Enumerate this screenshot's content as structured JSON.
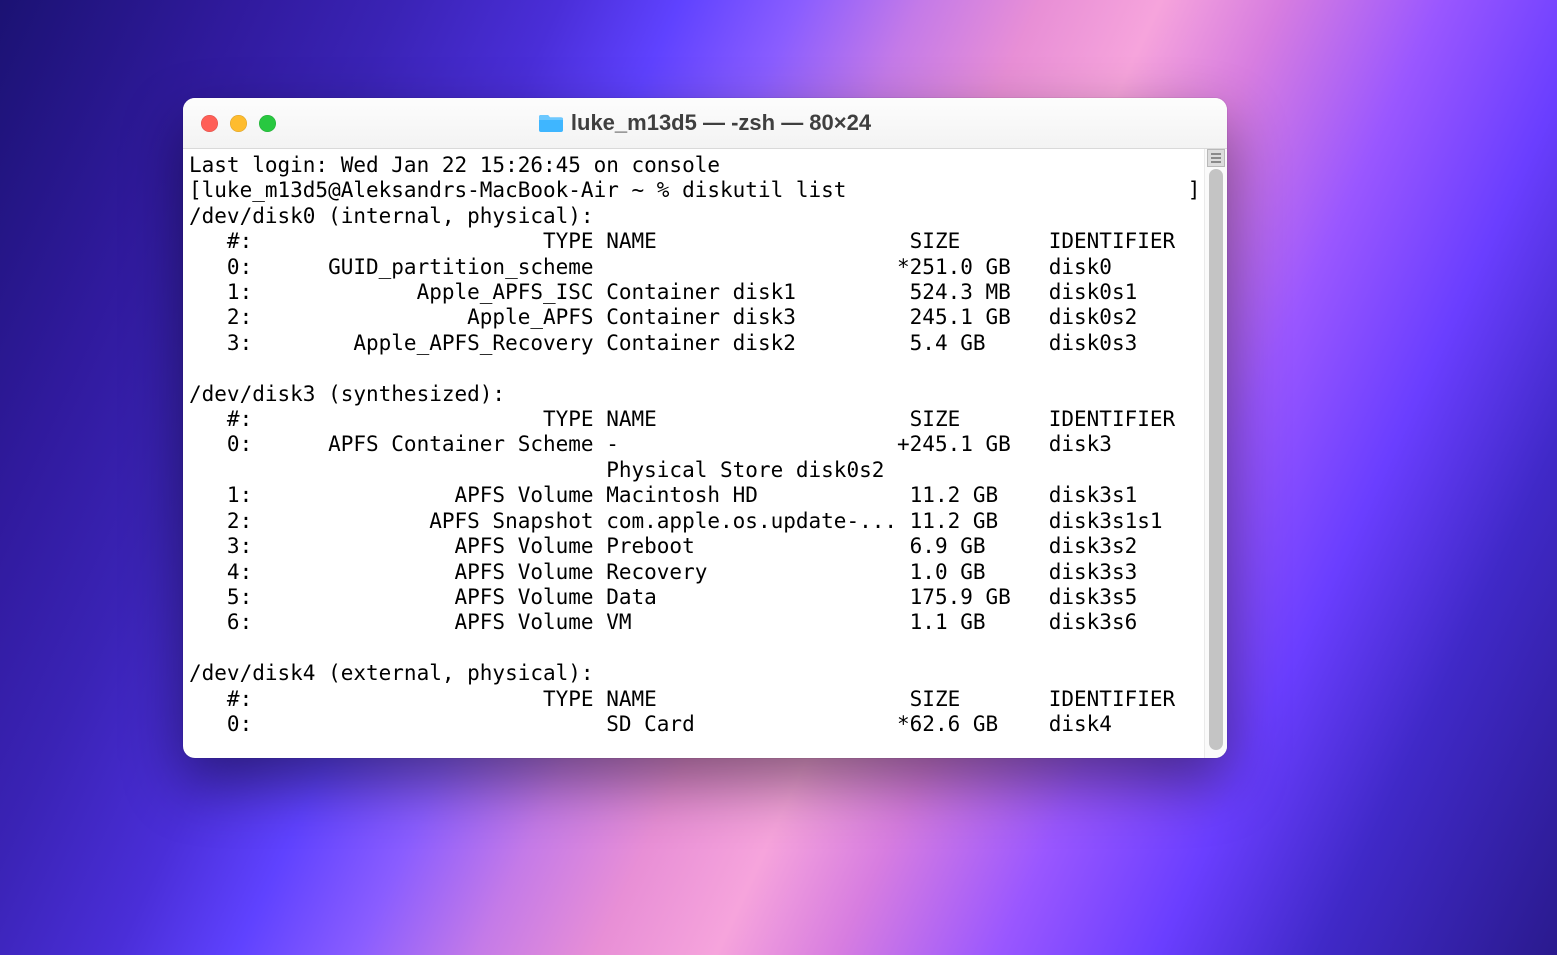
{
  "window": {
    "title": "luke_m13d5 — -zsh — 80×24"
  },
  "terminal": {
    "last_login": "Last login: Wed Jan 22 15:26:45 on console",
    "prompt_open": "[",
    "prompt": "luke_m13d5@Aleksandrs-MacBook-Air ~ % ",
    "command": "diskutil list",
    "prompt_close_col": 79,
    "disks": [
      {
        "header": "/dev/disk0 (internal, physical):",
        "columns": "   #:                       TYPE NAME                    SIZE       IDENTIFIER",
        "rows": [
          "   0:      GUID_partition_scheme                        *251.0 GB   disk0",
          "   1:             Apple_APFS_ISC Container disk1         524.3 MB   disk0s1",
          "   2:                 Apple_APFS Container disk3         245.1 GB   disk0s2",
          "   3:        Apple_APFS_Recovery Container disk2         5.4 GB     disk0s3"
        ]
      },
      {
        "header": "/dev/disk3 (synthesized):",
        "columns": "   #:                       TYPE NAME                    SIZE       IDENTIFIER",
        "rows": [
          "   0:      APFS Container Scheme -                      +245.1 GB   disk3",
          "                                 Physical Store disk0s2",
          "   1:                APFS Volume Macintosh HD            11.2 GB    disk3s1",
          "   2:              APFS Snapshot com.apple.os.update-... 11.2 GB    disk3s1s1",
          "   3:                APFS Volume Preboot                 6.9 GB     disk3s2",
          "   4:                APFS Volume Recovery                1.0 GB     disk3s3",
          "   5:                APFS Volume Data                    175.9 GB   disk3s5",
          "   6:                APFS Volume VM                      1.1 GB     disk3s6"
        ]
      },
      {
        "header": "/dev/disk4 (external, physical):",
        "columns": "   #:                       TYPE NAME                    SIZE       IDENTIFIER",
        "rows": [
          "   0:                            SD Card                *62.6 GB    disk4"
        ]
      }
    ]
  }
}
